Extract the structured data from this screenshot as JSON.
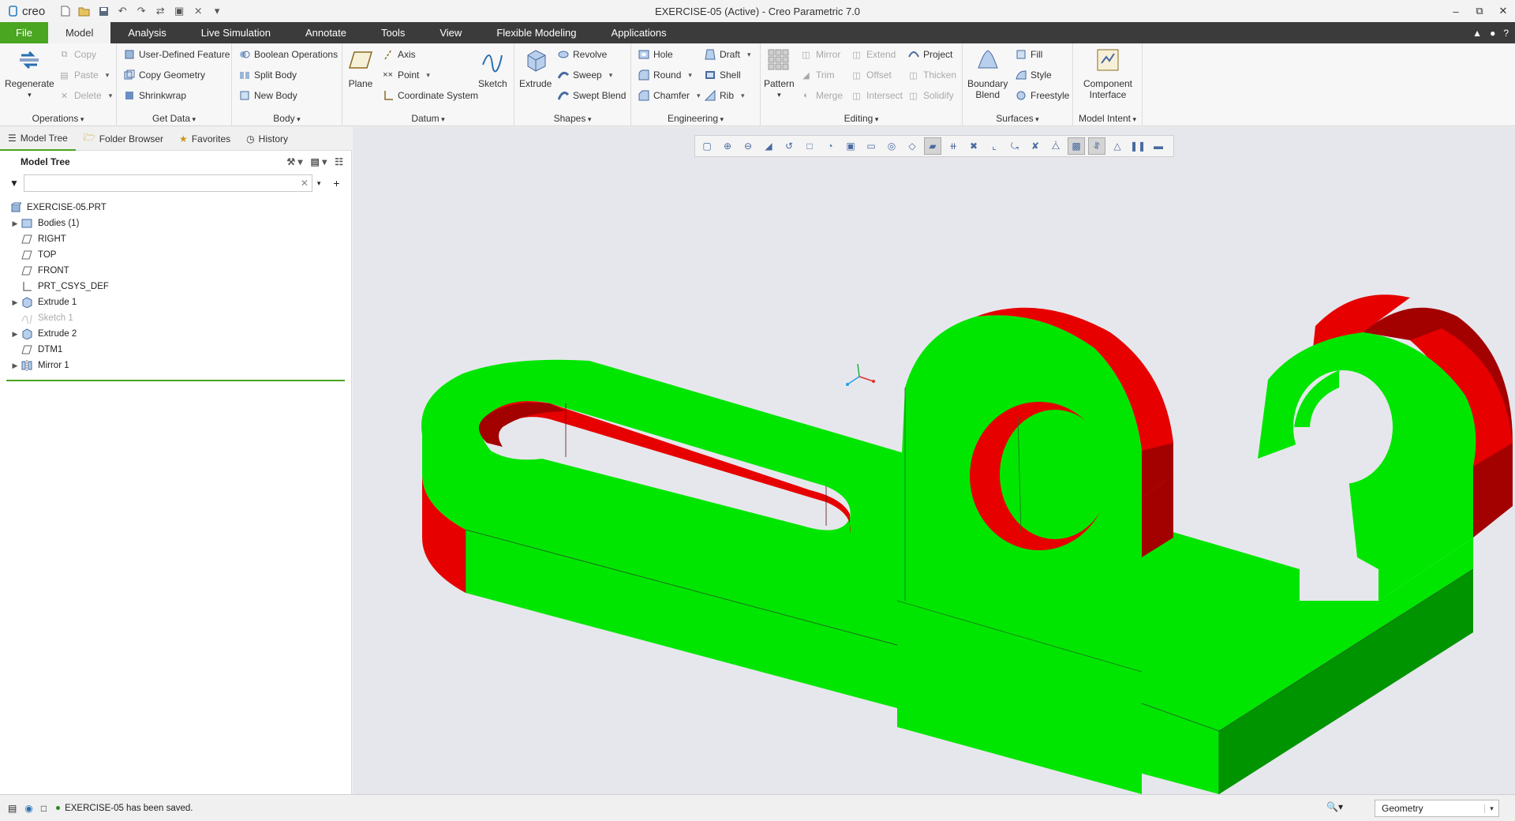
{
  "app": {
    "logo_text": "creo",
    "window_title": "EXERCISE-05 (Active) - Creo Parametric 7.0"
  },
  "quick_access": [
    "new-icon",
    "open-icon",
    "save-icon",
    "undo-icon",
    "redo-icon",
    "regenerate-icon",
    "window-icon",
    "close-window-icon",
    "customize-icon"
  ],
  "menu_tabs": [
    {
      "label": "File"
    },
    {
      "label": "Model"
    },
    {
      "label": "Analysis"
    },
    {
      "label": "Live Simulation"
    },
    {
      "label": "Annotate"
    },
    {
      "label": "Tools"
    },
    {
      "label": "View"
    },
    {
      "label": "Flexible Modeling"
    },
    {
      "label": "Applications"
    }
  ],
  "ribbon": {
    "operations": {
      "label": "Operations",
      "regenerate": "Regenerate",
      "copy": "Copy",
      "paste": "Paste",
      "delete": "Delete"
    },
    "get_data": {
      "label": "Get Data",
      "udf": "User-Defined Feature",
      "copy_geometry": "Copy Geometry",
      "shrinkwrap": "Shrinkwrap"
    },
    "body": {
      "label": "Body",
      "boolean": "Boolean Operations",
      "split": "Split Body",
      "new": "New Body"
    },
    "datum": {
      "label": "Datum",
      "plane": "Plane",
      "axis": "Axis",
      "point": "Point",
      "csys": "Coordinate System",
      "sketch": "Sketch"
    },
    "shapes": {
      "label": "Shapes",
      "extrude": "Extrude",
      "revolve": "Revolve",
      "sweep": "Sweep",
      "swept_blend": "Swept Blend"
    },
    "engineering": {
      "label": "Engineering",
      "hole": "Hole",
      "round": "Round",
      "chamfer": "Chamfer",
      "draft": "Draft",
      "shell": "Shell",
      "rib": "Rib"
    },
    "editing": {
      "label": "Editing",
      "pattern": "Pattern",
      "mirror": "Mirror",
      "trim": "Trim",
      "merge": "Merge",
      "extend": "Extend",
      "offset": "Offset",
      "intersect": "Intersect",
      "project": "Project",
      "thicken": "Thicken",
      "solidify": "Solidify"
    },
    "surfaces": {
      "label": "Surfaces",
      "boundary_blend_1": "Boundary",
      "boundary_blend_2": "Blend",
      "fill": "Fill",
      "style": "Style",
      "freestyle": "Freestyle"
    },
    "model_intent": {
      "label": "Model Intent",
      "component_1": "Component",
      "component_2": "Interface"
    }
  },
  "nav_tabs": [
    {
      "label": "Model Tree"
    },
    {
      "label": "Folder Browser"
    },
    {
      "label": "Favorites"
    },
    {
      "label": "History"
    }
  ],
  "model_tree": {
    "title": "Model Tree",
    "filter_value": "",
    "items": [
      {
        "label": "EXERCISE-05.PRT",
        "icon": "part-icon",
        "expandable": false,
        "dim": false
      },
      {
        "label": "Bodies (1)",
        "icon": "bodies-icon",
        "expandable": true,
        "dim": false
      },
      {
        "label": "RIGHT",
        "icon": "datum-plane-icon",
        "expandable": false,
        "dim": false
      },
      {
        "label": "TOP",
        "icon": "datum-plane-icon",
        "expandable": false,
        "dim": false
      },
      {
        "label": "FRONT",
        "icon": "datum-plane-icon",
        "expandable": false,
        "dim": false
      },
      {
        "label": "PRT_CSYS_DEF",
        "icon": "csys-icon",
        "expandable": false,
        "dim": false
      },
      {
        "label": "Extrude 1",
        "icon": "extrude-icon",
        "expandable": true,
        "dim": false
      },
      {
        "label": "Sketch 1",
        "icon": "sketch-icon",
        "expandable": false,
        "dim": true
      },
      {
        "label": "Extrude 2",
        "icon": "extrude-icon",
        "expandable": true,
        "dim": false
      },
      {
        "label": "DTM1",
        "icon": "datum-plane-icon",
        "expandable": false,
        "dim": false
      },
      {
        "label": "Mirror 1",
        "icon": "mirror-icon",
        "expandable": true,
        "dim": false
      }
    ]
  },
  "colors": {
    "accent": "#4aa520",
    "part_face": "#00e600",
    "part_face_dark": "#009400",
    "cut_face": "#e60000",
    "cut_face_dark": "#a30000",
    "viewport_bg": "#e6e7ec"
  },
  "status": {
    "message": "EXERCISE-05 has been saved.",
    "selection_filter": "Geometry"
  }
}
